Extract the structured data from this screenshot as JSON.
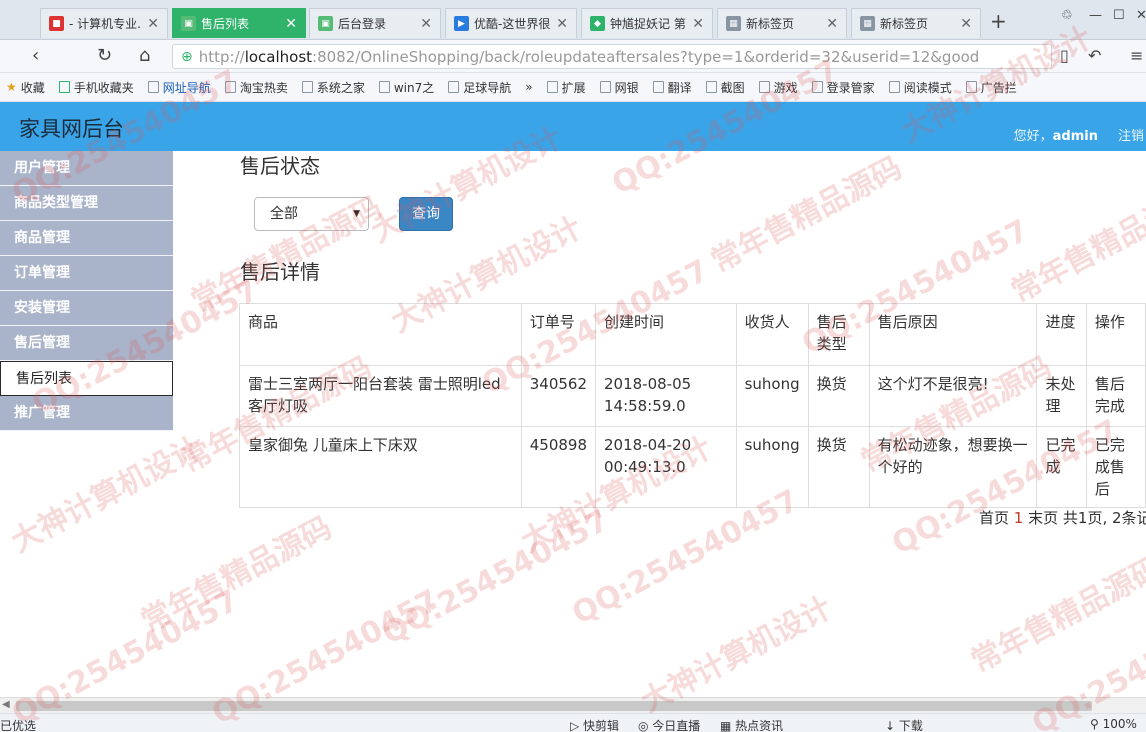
{
  "browser": {
    "tabs": [
      {
        "title": "- 计算机专业...",
        "favicon": "red-square-icon",
        "active": false
      },
      {
        "title": "售后列表",
        "favicon": "image-icon",
        "active": true
      },
      {
        "title": "后台登录",
        "favicon": "image-icon",
        "active": false
      },
      {
        "title": "优酷-这世界很...",
        "favicon": "youku-icon",
        "active": false
      },
      {
        "title": "钟馗捉妖记 第...",
        "favicon": "iqiyi-icon",
        "active": false
      },
      {
        "title": "新标签页",
        "favicon": "grid-icon",
        "active": false
      },
      {
        "title": "新标签页",
        "favicon": "grid-icon",
        "active": false
      }
    ],
    "url": {
      "prefix": "http://",
      "host": "localhost",
      "rest": ":8082/OnlineShopping/back/roleupdateaftersales?type=1&orderid=32&userid=12&good"
    },
    "bookmarks": [
      "收藏",
      "手机收藏夹",
      "网址导航",
      "淘宝热卖",
      "系统之家",
      "win7之",
      "足球导航",
      "»",
      "扩展",
      "网银",
      "翻译",
      "截图",
      "游戏",
      "登录管家",
      "阅读模式",
      "广告拦"
    ],
    "status_bar": [
      "已优选",
      "快剪辑",
      "今日直播",
      "热点资讯",
      "下载",
      "100%"
    ]
  },
  "header": {
    "brand": "家具网后台",
    "greeting_prefix": "您好，",
    "username": "admin",
    "logout": "注销"
  },
  "sidebar": {
    "items": [
      {
        "label": "用户管理",
        "type": "group"
      },
      {
        "label": "商品类型管理",
        "type": "group"
      },
      {
        "label": "商品管理",
        "type": "group"
      },
      {
        "label": "订单管理",
        "type": "group"
      },
      {
        "label": "安装管理",
        "type": "group"
      },
      {
        "label": "售后管理",
        "type": "group"
      },
      {
        "label": "售后列表",
        "type": "sub"
      },
      {
        "label": "推广管理",
        "type": "group"
      }
    ]
  },
  "main": {
    "status_title": "售后状态",
    "status_select": {
      "value": "全部"
    },
    "query_button": "查询",
    "detail_title": "售后详情",
    "table": {
      "columns": [
        "商品",
        "订单号",
        "创建时间",
        "收货人",
        "售后类型",
        "售后原因",
        "进度",
        "操作"
      ],
      "rows": [
        [
          "雷士三室两厅一阳台套装 雷士照明led客厅灯吸",
          "340562",
          "2018-08-05 14:58:59.0",
          "suhong",
          "换货",
          "这个灯不是很亮!",
          "未处理",
          "售后完成"
        ],
        [
          "皇家御兔 儿童床上下床双",
          "450898",
          "2018-04-20 00:49:13.0",
          "suhong",
          "换货",
          "有松动迹象，想要换一个好的",
          "已完成",
          "已完成售后"
        ]
      ]
    },
    "pager": {
      "first": "首页",
      "current": "1",
      "last": "末页",
      "total_pages": "共1页,",
      "total_items": "2条记"
    }
  },
  "watermarks": [
    "QQ:254540457",
    "常年售精品源码",
    "大神计算机设计"
  ]
}
